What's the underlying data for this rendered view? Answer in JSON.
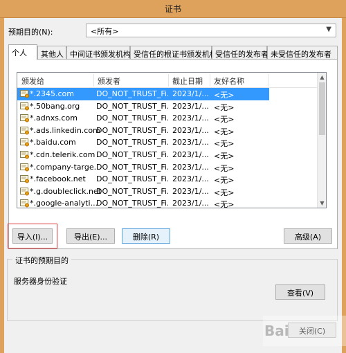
{
  "window": {
    "title": "证书"
  },
  "purpose": {
    "label": "预期目的(N):",
    "selected": "<所有>"
  },
  "tabs": [
    {
      "label": "个人"
    },
    {
      "label": "其他人"
    },
    {
      "label": "中间证书颁发机构"
    },
    {
      "label": "受信任的根证书颁发机构"
    },
    {
      "label": "受信任的发布者"
    },
    {
      "label": "未受信任的发布者"
    }
  ],
  "table": {
    "headers": [
      "颁发给",
      "颁发者",
      "截止日期",
      "友好名称"
    ],
    "rows": [
      {
        "issued_to": "*.2345.com",
        "issued_by": "DO_NOT_TRUST_Fi...",
        "expires": "2023/1/...",
        "friendly": "<无>"
      },
      {
        "issued_to": "*.50bang.org",
        "issued_by": "DO_NOT_TRUST_Fi...",
        "expires": "2023/1/...",
        "friendly": "<无>"
      },
      {
        "issued_to": "*.adnxs.com",
        "issued_by": "DO_NOT_TRUST_Fi...",
        "expires": "2023/1/...",
        "friendly": "<无>"
      },
      {
        "issued_to": "*.ads.linkedin.com",
        "issued_by": "DO_NOT_TRUST_Fi...",
        "expires": "2023/1/...",
        "friendly": "<无>"
      },
      {
        "issued_to": "*.baidu.com",
        "issued_by": "DO_NOT_TRUST_Fi...",
        "expires": "2023/1/...",
        "friendly": "<无>"
      },
      {
        "issued_to": "*.cdn.telerik.com",
        "issued_by": "DO_NOT_TRUST_Fi...",
        "expires": "2023/1/...",
        "friendly": "<无>"
      },
      {
        "issued_to": "*.company-targe...",
        "issued_by": "DO_NOT_TRUST_Fi...",
        "expires": "2023/1/...",
        "friendly": "<无>"
      },
      {
        "issued_to": "*.facebook.net",
        "issued_by": "DO_NOT_TRUST_Fi...",
        "expires": "2023/1/...",
        "friendly": "<无>"
      },
      {
        "issued_to": "*.g.doubleclick.net",
        "issued_by": "DO_NOT_TRUST_Fi...",
        "expires": "2023/1/...",
        "friendly": "<无>"
      },
      {
        "issued_to": "*.google-analyti...",
        "issued_by": "DO_NOT_TRUST_Fi...",
        "expires": "2023/1/...",
        "friendly": "<无>"
      }
    ]
  },
  "buttons": {
    "import": "导入(I)...",
    "export": "导出(E)...",
    "delete": "删除(R)",
    "advanced": "高级(A)",
    "view": "查看(V)",
    "close": "关闭(C)"
  },
  "purposes_group": {
    "title": "证书的预期目的",
    "text": "服务器身份验证"
  },
  "watermark": "Bai",
  "colors": {
    "titlebar": "#dfa25d",
    "selection": "#3399ff"
  }
}
